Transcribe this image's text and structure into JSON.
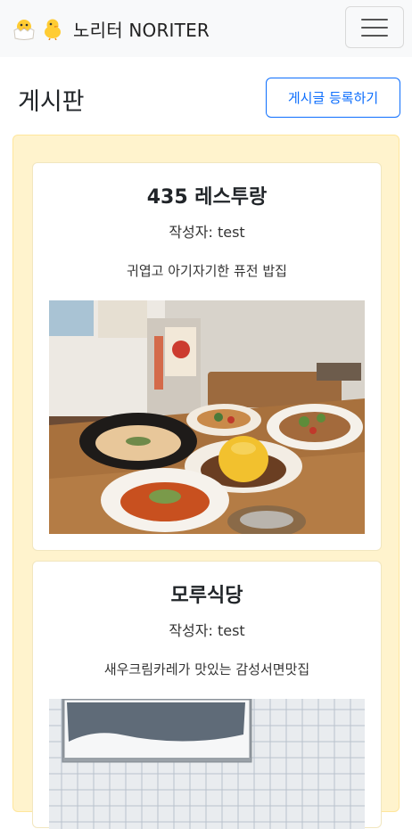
{
  "navbar": {
    "brand_emoji": "🐣🐥",
    "brand": "노리터 NORITER",
    "menu_icon": "hamburger-icon"
  },
  "page": {
    "title": "게시판",
    "write_button": "게시글 등록하기"
  },
  "posts": [
    {
      "title": "435 레스투랑",
      "author": "작성자: test",
      "description": "귀엽고 아기자기한 퓨전 밥집",
      "image": "fusion-food-table-photo"
    },
    {
      "title": "모루식당",
      "author": "작성자: test",
      "description": "새우크림카레가 맛있는 감성서면맛집",
      "image": "restaurant-window-photo"
    }
  ],
  "colors": {
    "accent": "#0d6efd",
    "board_bg": "#fff3cd",
    "navbar_bg": "#f8f9fa"
  }
}
